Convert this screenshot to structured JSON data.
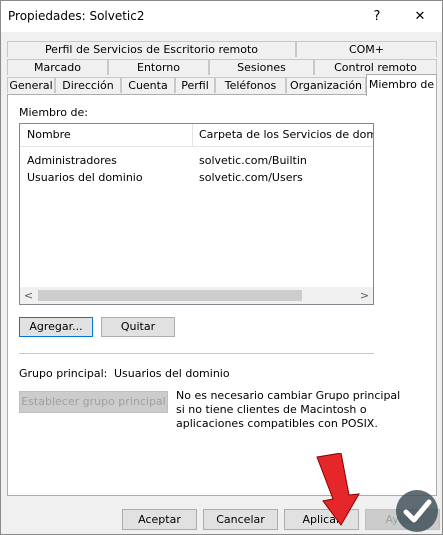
{
  "window": {
    "title": "Propiedades: Solvetic2",
    "help_glyph": "?",
    "close_glyph": "✕"
  },
  "tabs": {
    "row1": [
      "Perfil de Servicios de Escritorio remoto",
      "COM+"
    ],
    "row2": [
      "Marcado",
      "Entorno",
      "Sesiones",
      "Control remoto"
    ],
    "row3": [
      "General",
      "Dirección",
      "Cuenta",
      "Perfil",
      "Teléfonos",
      "Organización",
      "Miembro de"
    ],
    "active": "Miembro de"
  },
  "member_of": {
    "label": "Miembro de:",
    "columns": [
      "Nombre",
      "Carpeta de los Servicios de dominio d"
    ],
    "rows": [
      {
        "name": "Administradores",
        "folder": "solvetic.com/Builtin"
      },
      {
        "name": "Usuarios del dominio",
        "folder": "solvetic.com/Users"
      }
    ],
    "scroll_left": "<",
    "scroll_right": ">"
  },
  "buttons": {
    "add": "Agregar...",
    "remove": "Quitar",
    "set_primary": "Establecer grupo principal",
    "accept": "Aceptar",
    "cancel": "Cancelar",
    "apply": "Aplicar",
    "help": "Ayuda"
  },
  "primary_group": {
    "label": "Grupo principal:",
    "value": "Usuarios del dominio",
    "note_lines": [
      "No es necesario cambiar Grupo principal",
      "si no tiene clientes de Macintosh o",
      "aplicaciones compatibles con POSIX."
    ]
  },
  "colors": {
    "arrow": "#e5272a",
    "logo": "#3a4a52",
    "focus": "#0078d7"
  }
}
